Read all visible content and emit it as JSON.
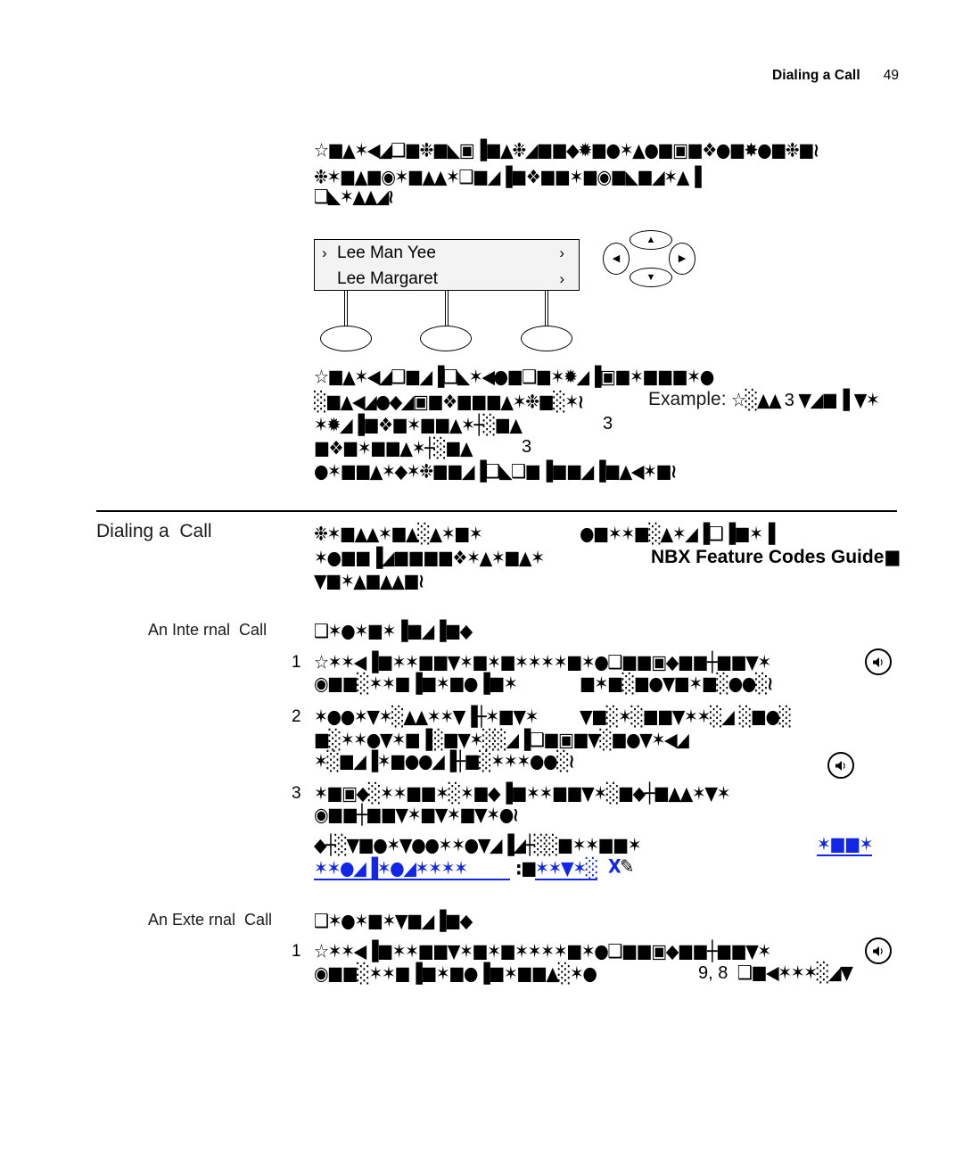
{
  "header": {
    "title": "Dialing a Call",
    "page_number": "49"
  },
  "lcd": {
    "rows": [
      {
        "selector": "›",
        "name": "Lee Man Yee",
        "chevron": "›"
      },
      {
        "selector": "",
        "name": "Lee Margaret",
        "chevron": "›"
      }
    ]
  },
  "navpad": {
    "up": "▲",
    "down": "▼",
    "left": "◀",
    "right": "▶"
  },
  "body": {
    "intro": [
      "☆■▲✶◀◢❑■❉■◣▣▐■▲❉◢■■◆✹■●✶▲●■▣■❖●■✸●■❉■≀",
      "❉✶■▲■◉✶■▲▲✶❑■◢▐■❖■■✶■◉■◣■◢✶▲▐",
      "❑◣✶▲▲◢≀"
    ],
    "mid": [
      "☆■▲✶◀◢❑■◢▐❑◣✶◀●■❑■✶✹◢▐▣■✶■■■✶●",
      "░■▲◀◢●◆◢▣■❖■■■▲✶❉■░✶≀",
      "✶✹◢▐■❖■✶■■▲✶┼░■▲",
      "■❖■✶■■▲✶┼░■▲",
      "●✶■■▲✶◆✶❉■■◢▐❑◣❑■▐■■◢▐■▲◀✶■≀"
    ],
    "example_label": "Example:",
    "example_glyphs_a": "☆░▲▲",
    "example_digit": "3",
    "example_glyphs_b": "▼◢■▐ ▼✶",
    "mid_digit_1": "3",
    "mid_digit_2": "3"
  },
  "sections": [
    {
      "heading": "Dialing a  Call",
      "paragraph_glyphs": [
        "❉✶■▲▲✶■▲░▲✶■✶",
        "✶●■■▐◢■■■■❖✶▲✶■▲✶",
        "▼■✶▲■▲▲■≀"
      ],
      "right_glyphs": "●■✶✶■░▲✶◢▐❑▐■✶▐",
      "right_bold_text": "NBX Feature Codes Guide",
      "right_bold_tail": "■"
    }
  ],
  "internal": {
    "heading": "An Inte rnal  Call",
    "heading_glyphs": "❑✶●✶■✶▐■◢▐■◆",
    "steps": [
      {
        "num": "1",
        "lines": [
          "☆✶✶◀▐■✶✶■■▼✶■✶■✶✶✶✶■✶●❑■■▣◆■■┼■■▼✶",
          "◉■■░✶✶■▐■✶■●▐■✶",
          "■✶■░■●▼■✶■░●●░≀"
        ],
        "has_speaker_icon": true
      },
      {
        "num": "2",
        "lines": [
          "✶●●✶▼✶░▲▲✶✶▼▐┼✶■▼✶",
          "▼■░✶░■■▼✶✶░◢ ░■●░",
          "■░✶✶●▼✶■▐░■▼✶░░◢▐❑■▣■▼░■●▼✶◀◢",
          "✶░■◢▐✶■●●◢▐┼■░✶✶✶●●░≀"
        ],
        "has_speaker_icon": false
      },
      {
        "num": "3",
        "lines": [
          "✶■▣◆░✶✶■■✶░✶■◆▐■✶✶■■▼✶░■◆┼■▲▲✶▼✶",
          "◉■■┼■■▼✶■▼✶■▼✶●≀"
        ],
        "has_speaker_icon": true
      }
    ],
    "note_glyphs": "◆┼░▼■●✶▼●●✶✶●▼◢▐◢┼░░■✶✶■■✶",
    "note_link_right": "✶■■✶",
    "link_line_glyphs": "✶✶●◢▐✶●◢✶✶✶✶",
    "link_sep": ":■",
    "link_mid": "✶✶▼✶░",
    "link_x": "X",
    "link_tail": "✎"
  },
  "external": {
    "heading": "An Exte rnal  Call",
    "heading_glyphs": "❑✶●✶■✶▼■◢▐■◆",
    "steps": [
      {
        "num": "1",
        "lines": [
          "☆✶✶◀▐■✶✶■■▼✶■✶■✶✶✶✶■✶●❑■■▣◆■■┼■■▼✶",
          "◉■■░✶✶■▐■✶■●▐■✶■■▲░✶●"
        ],
        "dial_digits": "9, 8",
        "dial_glyphs": "❑■◀✶✶✶░◢▼",
        "has_speaker_icon": true
      }
    ]
  },
  "colors": {
    "link": "#1226e8",
    "text": "#000000",
    "lcd_bg": "#f3f3f3"
  },
  "icons": {
    "speaker": "speakerphone-icon",
    "chevron_right": "›"
  }
}
